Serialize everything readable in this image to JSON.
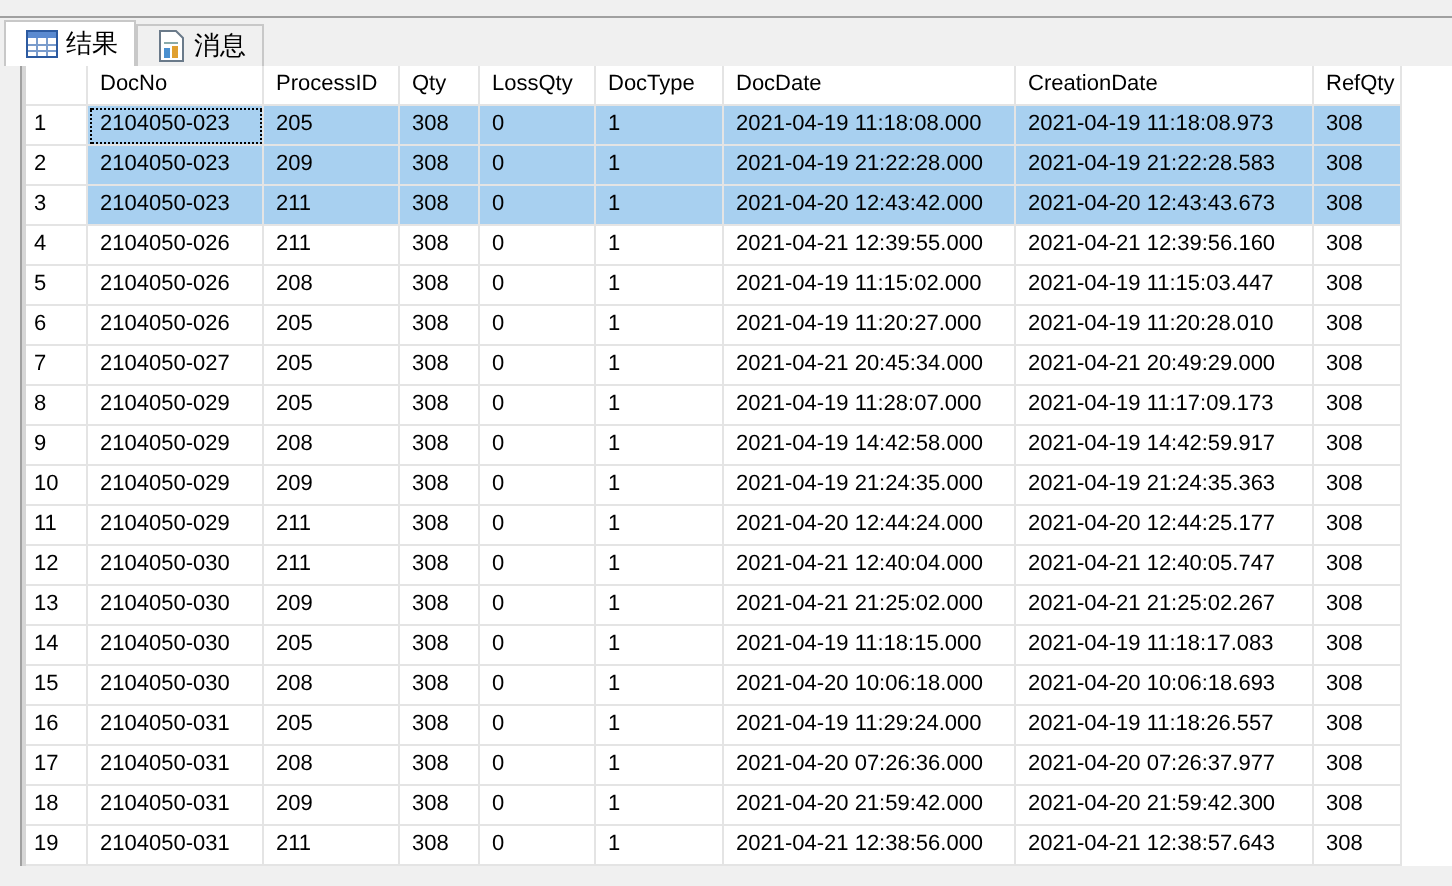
{
  "tabs": [
    {
      "label": "结果",
      "selected": true
    },
    {
      "label": "消息",
      "selected": false
    }
  ],
  "table": {
    "columns": [
      "DocNo",
      "ProcessID",
      "Qty",
      "LossQty",
      "DocType",
      "DocDate",
      "CreationDate",
      "RefQty"
    ],
    "rows": [
      {
        "num": "1",
        "selected": true,
        "focused": true,
        "cells": [
          "2104050-023",
          "205",
          "308",
          "0",
          "1",
          "2021-04-19 11:18:08.000",
          "2021-04-19 11:18:08.973",
          "308"
        ]
      },
      {
        "num": "2",
        "selected": true,
        "focused": false,
        "cells": [
          "2104050-023",
          "209",
          "308",
          "0",
          "1",
          "2021-04-19 21:22:28.000",
          "2021-04-19 21:22:28.583",
          "308"
        ]
      },
      {
        "num": "3",
        "selected": true,
        "focused": false,
        "cells": [
          "2104050-023",
          "211",
          "308",
          "0",
          "1",
          "2021-04-20 12:43:42.000",
          "2021-04-20 12:43:43.673",
          "308"
        ]
      },
      {
        "num": "4",
        "selected": false,
        "focused": false,
        "cells": [
          "2104050-026",
          "211",
          "308",
          "0",
          "1",
          "2021-04-21 12:39:55.000",
          "2021-04-21 12:39:56.160",
          "308"
        ]
      },
      {
        "num": "5",
        "selected": false,
        "focused": false,
        "cells": [
          "2104050-026",
          "208",
          "308",
          "0",
          "1",
          "2021-04-19 11:15:02.000",
          "2021-04-19 11:15:03.447",
          "308"
        ]
      },
      {
        "num": "6",
        "selected": false,
        "focused": false,
        "cells": [
          "2104050-026",
          "205",
          "308",
          "0",
          "1",
          "2021-04-19 11:20:27.000",
          "2021-04-19 11:20:28.010",
          "308"
        ]
      },
      {
        "num": "7",
        "selected": false,
        "focused": false,
        "cells": [
          "2104050-027",
          "205",
          "308",
          "0",
          "1",
          "2021-04-21 20:45:34.000",
          "2021-04-21 20:49:29.000",
          "308"
        ]
      },
      {
        "num": "8",
        "selected": false,
        "focused": false,
        "cells": [
          "2104050-029",
          "205",
          "308",
          "0",
          "1",
          "2021-04-19 11:28:07.000",
          "2021-04-19 11:17:09.173",
          "308"
        ]
      },
      {
        "num": "9",
        "selected": false,
        "focused": false,
        "cells": [
          "2104050-029",
          "208",
          "308",
          "0",
          "1",
          "2021-04-19 14:42:58.000",
          "2021-04-19 14:42:59.917",
          "308"
        ]
      },
      {
        "num": "10",
        "selected": false,
        "focused": false,
        "cells": [
          "2104050-029",
          "209",
          "308",
          "0",
          "1",
          "2021-04-19 21:24:35.000",
          "2021-04-19 21:24:35.363",
          "308"
        ]
      },
      {
        "num": "11",
        "selected": false,
        "focused": false,
        "cells": [
          "2104050-029",
          "211",
          "308",
          "0",
          "1",
          "2021-04-20 12:44:24.000",
          "2021-04-20 12:44:25.177",
          "308"
        ]
      },
      {
        "num": "12",
        "selected": false,
        "focused": false,
        "cells": [
          "2104050-030",
          "211",
          "308",
          "0",
          "1",
          "2021-04-21 12:40:04.000",
          "2021-04-21 12:40:05.747",
          "308"
        ]
      },
      {
        "num": "13",
        "selected": false,
        "focused": false,
        "cells": [
          "2104050-030",
          "209",
          "308",
          "0",
          "1",
          "2021-04-21 21:25:02.000",
          "2021-04-21 21:25:02.267",
          "308"
        ]
      },
      {
        "num": "14",
        "selected": false,
        "focused": false,
        "cells": [
          "2104050-030",
          "205",
          "308",
          "0",
          "1",
          "2021-04-19 11:18:15.000",
          "2021-04-19 11:18:17.083",
          "308"
        ]
      },
      {
        "num": "15",
        "selected": false,
        "focused": false,
        "cells": [
          "2104050-030",
          "208",
          "308",
          "0",
          "1",
          "2021-04-20 10:06:18.000",
          "2021-04-20 10:06:18.693",
          "308"
        ]
      },
      {
        "num": "16",
        "selected": false,
        "focused": false,
        "cells": [
          "2104050-031",
          "205",
          "308",
          "0",
          "1",
          "2021-04-19 11:29:24.000",
          "2021-04-19 11:18:26.557",
          "308"
        ]
      },
      {
        "num": "17",
        "selected": false,
        "focused": false,
        "cells": [
          "2104050-031",
          "208",
          "308",
          "0",
          "1",
          "2021-04-20 07:26:36.000",
          "2021-04-20 07:26:37.977",
          "308"
        ]
      },
      {
        "num": "18",
        "selected": false,
        "focused": false,
        "cells": [
          "2104050-031",
          "209",
          "308",
          "0",
          "1",
          "2021-04-20 21:59:42.000",
          "2021-04-20 21:59:42.300",
          "308"
        ]
      },
      {
        "num": "19",
        "selected": false,
        "focused": false,
        "cells": [
          "2104050-031",
          "211",
          "308",
          "0",
          "1",
          "2021-04-21 12:38:56.000",
          "2021-04-21 12:38:57.643",
          "308"
        ]
      }
    ]
  }
}
